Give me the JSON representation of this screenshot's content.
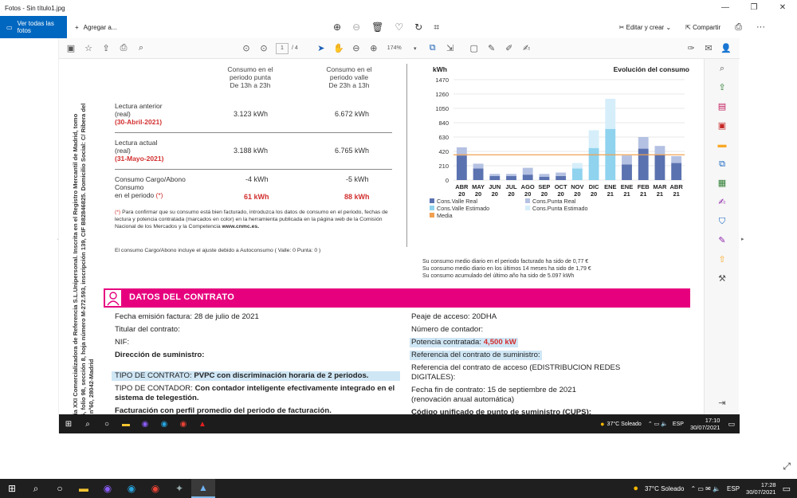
{
  "window": {
    "title": "Fotos - Sin título1.jpg"
  },
  "photos_toolbar": {
    "see_all": "Ver todas las fotos",
    "add_to": "Agregar a...",
    "edit_create": "Editar y crear",
    "share": "Compartir"
  },
  "pdf_toolbar": {
    "page_current": "1",
    "page_total": "/ 4",
    "zoom": "174%"
  },
  "document": {
    "vertical_text": "Energía XXI Comercializadora de Referencia S.L.Unipersonal. Inscrita en el Registro Mercantil de Madrid, tomo 30.086, folio 98, sección 8, hoja número M-272.593, inscripción 139, CIF B82846825. Domicilio Social: C/ Ribera del Loira, nº60, 28042-Madrid",
    "consumption": {
      "head_punta": [
        "Consumo en el",
        "periodo punta",
        "De 13h a 23h"
      ],
      "head_valle": [
        "Consumo en el",
        "periodo valle",
        "De 23h a 13h"
      ],
      "prev_label": [
        "Lectura anterior",
        "(real)"
      ],
      "prev_date": "(30-Abril-2021)",
      "prev_punta": "3.123 kWh",
      "prev_valle": "6.672 kWh",
      "curr_label": [
        "Lectura actual",
        "(real)"
      ],
      "curr_date": "(31-Mayo-2021)",
      "curr_punta": "3.188 kWh",
      "curr_valle": "6.765 kWh",
      "cargo_label": [
        "Consumo Cargo/Abono",
        "Consumo"
      ],
      "period_label": "en el periodo",
      "asterisk": "(*)",
      "cargo_punta": "-4 kWh",
      "cargo_valle": "-5 kWh",
      "period_punta": "61 kWh",
      "period_valle": "88 kWh",
      "note_star": "(*)",
      "note": "Para confirmar que su consumo está bien facturado, introduzca los datos de consumo en el periodo, fechas de lectura y potencia contratada (marcados en color) en la herramienta publicada en la página web de la Comisión Nacional de los Mercados y la Competencia",
      "note_url": "www.cnmc.es.",
      "note2": "El consumo Cargo/Abono incluye el ajuste debido a Autoconsumo ( Valle: 0 Punta: 0 )"
    },
    "summary": [
      "Su consumo medio diario en el periodo facturado ha sido de  0,77 €",
      "Su consumo medio diario en los últimos 14 meses ha sido de  1,79 €",
      "Su consumo acumulado del último año ha sido de  5.097 kWh"
    ],
    "contract": {
      "title": "DATOS DEL CONTRATO",
      "emission": "Fecha emisión factura: 28 de julio de 2021",
      "holder": "Titular del contrato:",
      "nif": "NIF:",
      "address": "Dirección de suministro:",
      "type_label": "TIPO DE CONTRATO:",
      "type_value": "PVPC con discriminación horaria de 2 periodos.",
      "meter_label": "TIPO DE CONTADOR:",
      "meter_value": "Con contador inteligente efectivamente integrado en el sistema de telegestión.",
      "billing": "Facturación con perfil promedio del periodo de facturación.",
      "toll": "Peaje de acceso: 20DHA",
      "meter_number": "Número de contador:",
      "power_label": "Potencia contratada:",
      "power_value": "4,500 kW",
      "supply_ref": "Referencia del contrato de suministro:",
      "access_ref": "Referencia del contrato de acceso (EDISTRIBUCION REDES DIGITALES):",
      "end_date": "Fecha fin de contrato: 15 de septiembre de 2021",
      "renewal": "(renovación anual automática)",
      "cups": "Código unificado de punto de suministro (CUPS):"
    }
  },
  "chart_data": {
    "type": "bar",
    "title": "Evolución del consumo",
    "ylabel": "kWh",
    "ylim": [
      0,
      1470
    ],
    "yticks": [
      0,
      210,
      420,
      630,
      840,
      1050,
      1260,
      1470
    ],
    "categories": [
      [
        "ABR",
        "20"
      ],
      [
        "MAY",
        "20"
      ],
      [
        "JUN",
        "20"
      ],
      [
        "JUL",
        "20"
      ],
      [
        "AGO",
        "20"
      ],
      [
        "SEP",
        "20"
      ],
      [
        "OCT",
        "20"
      ],
      [
        "NOV",
        "20"
      ],
      [
        "DIC",
        "20"
      ],
      [
        "ENE",
        "21"
      ],
      [
        "ENE",
        "21"
      ],
      [
        "FEB",
        "21"
      ],
      [
        "MAR",
        "21"
      ],
      [
        "ABR",
        "21"
      ]
    ],
    "series": [
      {
        "name": "Cons.Valle Real",
        "color": "#5b72b0",
        "values": [
          360,
          170,
          60,
          60,
          80,
          50,
          60,
          0,
          0,
          0,
          230,
          460,
          370,
          250
        ]
      },
      {
        "name": "Cons.Punta Real",
        "color": "#b4c1e2",
        "values": [
          120,
          70,
          30,
          30,
          100,
          40,
          50,
          0,
          0,
          0,
          130,
          170,
          130,
          100
        ]
      },
      {
        "name": "Cons.Valle Estimado",
        "color": "#8fd3ee",
        "values": [
          0,
          0,
          0,
          0,
          0,
          0,
          0,
          170,
          470,
          750,
          0,
          0,
          0,
          0
        ]
      },
      {
        "name": "Cons.Punta Estimado",
        "color": "#d5eefa",
        "values": [
          0,
          0,
          0,
          0,
          0,
          0,
          0,
          80,
          260,
          440,
          0,
          0,
          0,
          0
        ]
      }
    ],
    "media": {
      "name": "Media",
      "color": "#f0a050",
      "value": 370
    },
    "legend_position": "bottom"
  },
  "inner_taskbar": {
    "weather": "37°C  Soleado",
    "lang": "ESP",
    "time": "17:10",
    "date": "30/07/2021"
  },
  "taskbar": {
    "weather": "37°C  Soleado",
    "lang": "ESP",
    "time": "17:28",
    "date": "30/07/2021"
  }
}
